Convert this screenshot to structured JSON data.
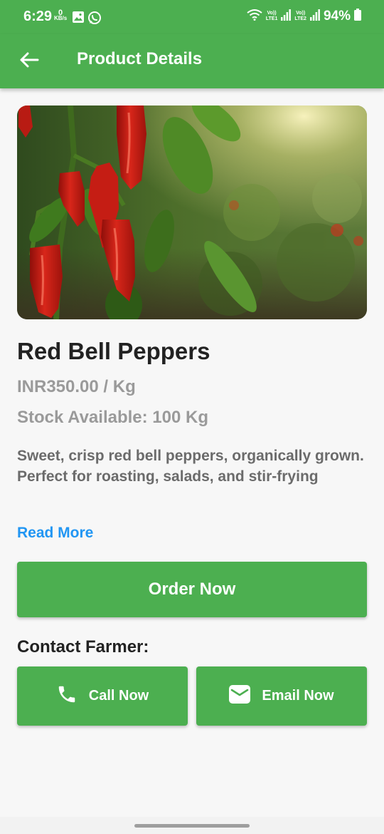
{
  "status_bar": {
    "time": "6:29",
    "net_speed_value": "0",
    "net_speed_unit": "KB/s",
    "sim1_label": "LTE1",
    "sim2_label": "LTE2",
    "volte_label": "Vo))",
    "battery_percent": "94%"
  },
  "app_bar": {
    "title": "Product Details",
    "back_icon": "arrow-left-icon"
  },
  "product": {
    "name": "Red Bell Peppers",
    "price": "INR350.00 / Kg",
    "stock": "Stock Available: 100 Kg",
    "description": "Sweet, crisp red bell peppers, organically grown. Perfect for roasting, salads, and stir-frying",
    "read_more": "Read More"
  },
  "actions": {
    "order_label": "Order Now",
    "contact_heading": "Contact Farmer:",
    "call_label": "Call Now",
    "email_label": "Email Now"
  },
  "colors": {
    "primary": "#4caf50",
    "link": "#2196f3",
    "background": "#f7f7f7"
  }
}
